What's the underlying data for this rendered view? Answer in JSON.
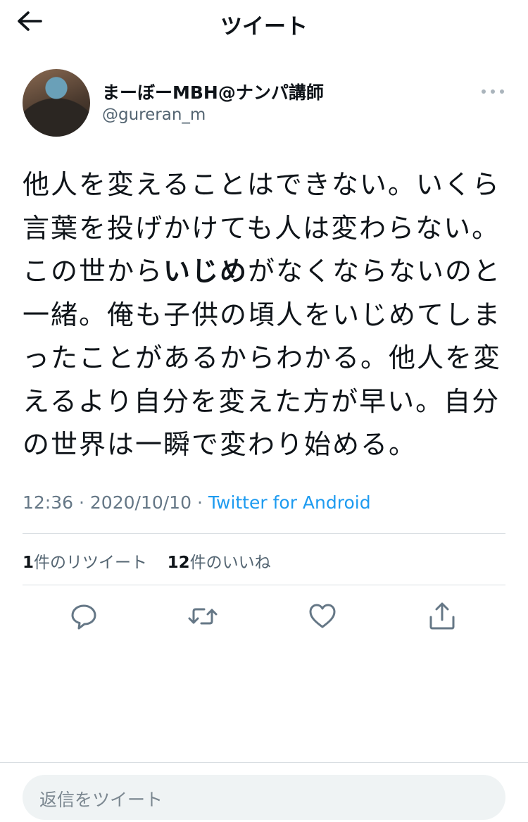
{
  "header": {
    "title": "ツイート",
    "back_icon": "back-arrow-icon"
  },
  "author": {
    "display_name": "まーぼーMBH@ナンパ講師",
    "handle": "@gureran_m",
    "more_icon": "more-dots-icon"
  },
  "tweet": {
    "text_before": "他人を変えることはできない。いくら言葉を投げかけても人は変わらない。この世から",
    "text_bold": "いじめ",
    "text_after": "がなくならないのと一緒。俺も子供の頃人をいじめてしまったことがあるからわかる。他人を変えるより自分を変えた方が早い。自分の世界は一瞬で変わり始める。",
    "time": "12:36",
    "date": "2020/10/10",
    "separator": "·",
    "source": "Twitter for Android"
  },
  "stats": {
    "retweets_count": "1",
    "retweets_label": "件のリツイート",
    "likes_count": "12",
    "likes_label": "件のいいね"
  },
  "actions": [
    "reply-icon",
    "retweet-icon",
    "like-icon",
    "share-icon"
  ],
  "reply": {
    "placeholder": "返信をツイート"
  },
  "colors": {
    "link": "#1d9bf0",
    "secondary": "#657786",
    "divider": "#d9dee2"
  }
}
